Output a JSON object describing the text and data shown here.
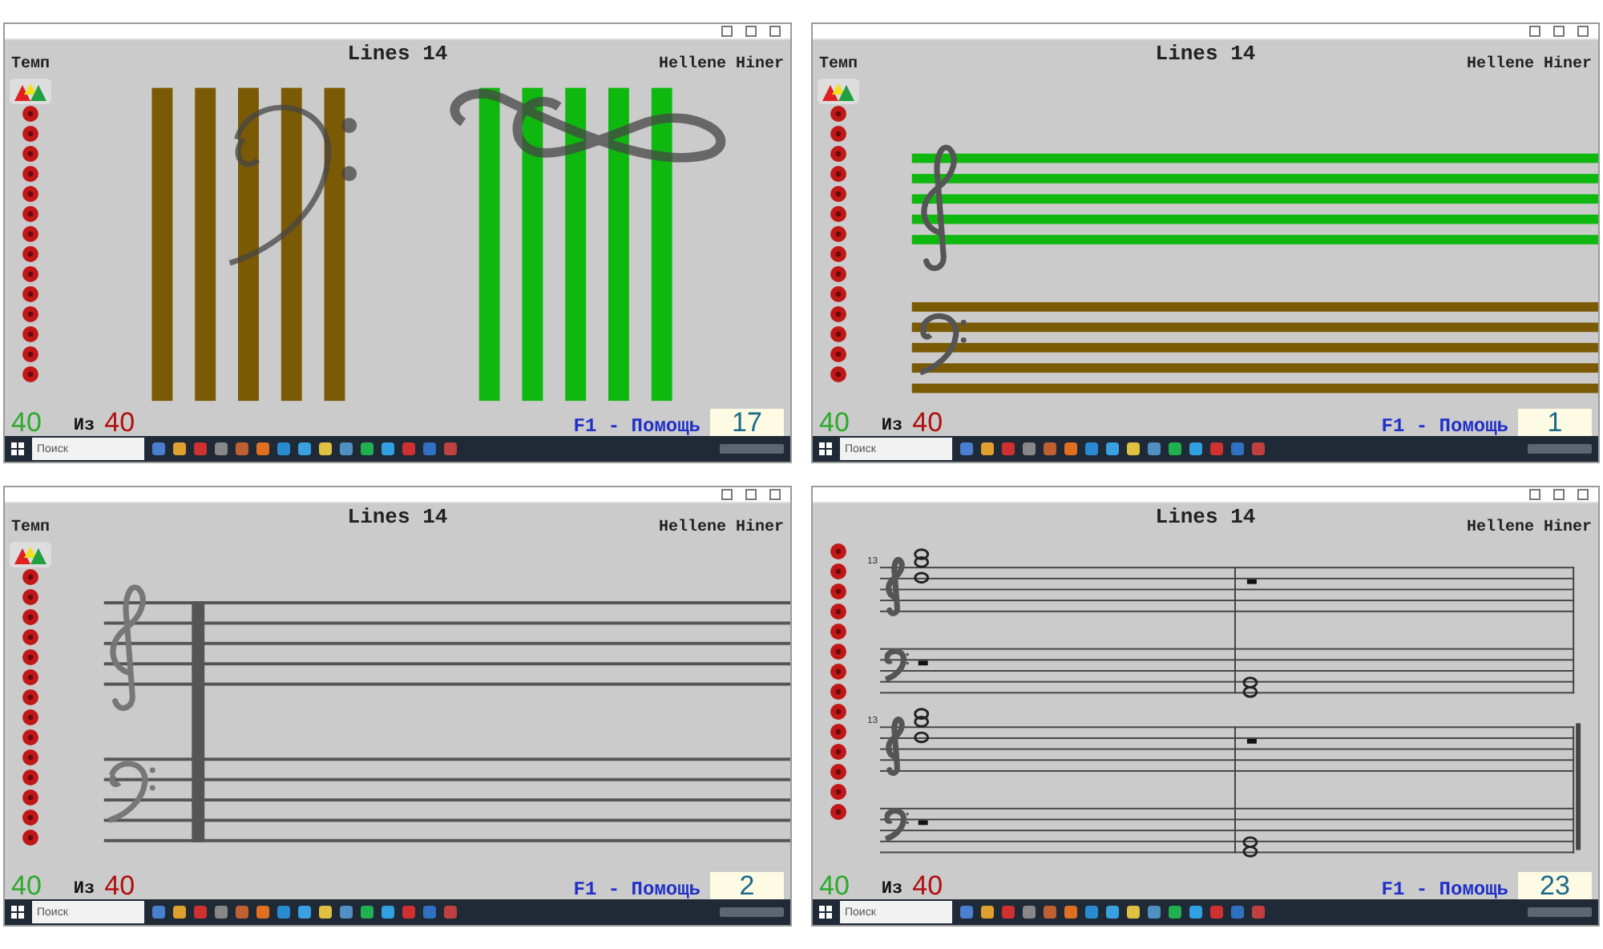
{
  "panels": [
    {
      "kind": "bars",
      "title": "Lines 14",
      "tempo_label": "Темп",
      "author": "Hellene Hiner",
      "score": "40",
      "of_label": "Из",
      "total": "40",
      "help": "F1 - Помощь",
      "counter": "17",
      "search_placeholder": "Поиск"
    },
    {
      "kind": "staff-colored",
      "title": "Lines 14",
      "tempo_label": "Темп",
      "author": "Hellene Hiner",
      "score": "40",
      "of_label": "Из",
      "total": "40",
      "help": "F1 - Помощь",
      "counter": "1",
      "search_placeholder": "Поиск"
    },
    {
      "kind": "staff-plain",
      "title": "Lines 14",
      "tempo_label": "Темп",
      "author": "Hellene Hiner",
      "score": "40",
      "of_label": "Из",
      "total": "40",
      "help": "F1 - Помощь",
      "counter": "2",
      "search_placeholder": "Поиск"
    },
    {
      "kind": "score",
      "title": "Lines 14",
      "author": "Hellene Hiner",
      "measure_numbers": [
        "13",
        "13"
      ],
      "score": "40",
      "of_label": "Из",
      "total": "40",
      "help": "F1 - Помощь",
      "counter": "23",
      "search_placeholder": "Поиск"
    }
  ]
}
